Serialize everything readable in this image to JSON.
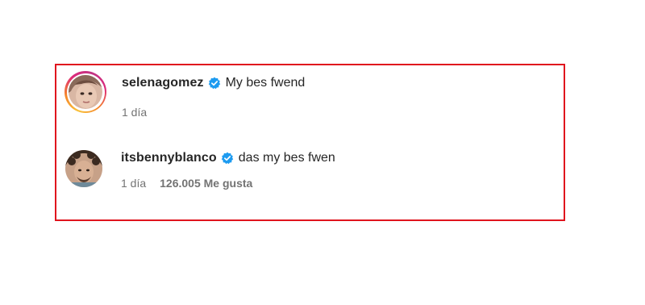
{
  "comments": [
    {
      "username": "selenagomez",
      "verified": true,
      "text": "My bes fwend",
      "time": "1 día",
      "likes": ""
    },
    {
      "username": "itsbennyblanco",
      "verified": true,
      "text": "das my bes fwen",
      "time": "1 día",
      "likes": "126.005 Me gusta"
    }
  ],
  "colors": {
    "highlight_border": "#e0141e",
    "verified_blue": "#1d9bf0",
    "primary_text": "#262626",
    "secondary_text": "#737373"
  },
  "icons": {
    "verified": "verified-badge-icon",
    "story_ring": "story-ring"
  }
}
